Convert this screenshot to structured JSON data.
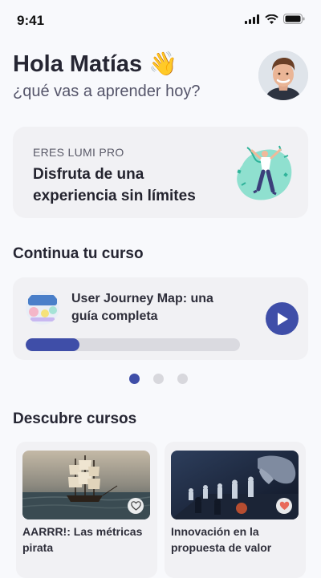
{
  "status": {
    "time": "9:41"
  },
  "header": {
    "greeting": "Hola Matías 👋",
    "subtitle": "¿qué vas a aprender hoy?"
  },
  "promo": {
    "kicker": "ERES LUMI PRO",
    "title": "Disfruta de una experiencia sin límites"
  },
  "continue_section": {
    "title": "Continua tu curso",
    "course": {
      "title": "User Journey Map: una guía completa",
      "progress": 0.25
    },
    "pagination": {
      "pages": 3,
      "active": 1
    }
  },
  "discover_section": {
    "title": "Descubre cursos",
    "courses": [
      {
        "title": "AARRR!: Las métricas pirata",
        "favorited": false
      },
      {
        "title": "Innovación en la propuesta de valor",
        "favorited": true
      }
    ]
  },
  "colors": {
    "accent": "#3f4ea8",
    "heart_active": "#e8695a",
    "background": "#f8f9fc",
    "card": "#f1f1f4"
  }
}
